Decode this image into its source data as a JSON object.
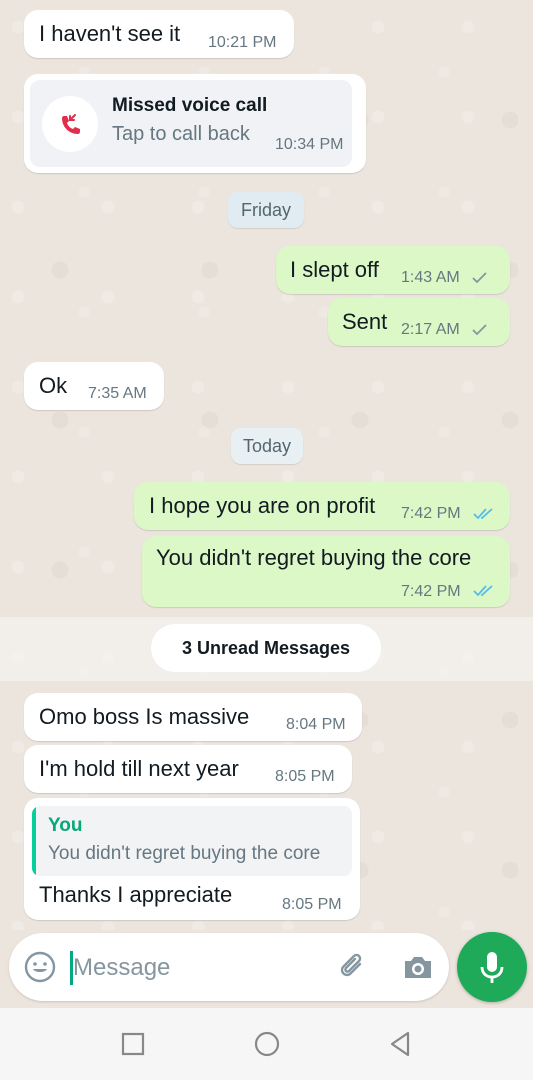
{
  "messages": {
    "m1": {
      "text": "I haven't see it",
      "time": "10:21 PM"
    },
    "call": {
      "title": "Missed voice call",
      "subtitle": "Tap to call back",
      "time": "10:34 PM",
      "icon": "missed-call-icon"
    },
    "day_friday": "Friday",
    "m2": {
      "text": "I slept off",
      "time": "1:43 AM"
    },
    "m3": {
      "text": "Sent",
      "time": "2:17 AM"
    },
    "m4": {
      "text": "Ok",
      "time": "7:35 AM"
    },
    "day_today": "Today",
    "m5": {
      "text": "I hope you are on profit",
      "time": "7:42 PM"
    },
    "m6": {
      "text": "You didn't regret buying the core",
      "time": "7:42 PM"
    },
    "unread_label": "3 Unread Messages",
    "m7": {
      "text": "Omo boss Is massive",
      "time": "8:04 PM"
    },
    "m8": {
      "text": "I'm hold till next year",
      "time": "8:05 PM"
    },
    "m9": {
      "quote_author": "You",
      "quote_text": "You didn't regret buying the core",
      "text": "Thanks I appreciate",
      "time": "8:05 PM"
    }
  },
  "composer": {
    "placeholder": "Message"
  },
  "colors": {
    "outgoing_bubble": "#dcf8c6",
    "incoming_bubble": "#ffffff",
    "accent_green": "#1faa59",
    "read_tick_blue": "#53bdeb",
    "missed_call_red": "#e02e4c",
    "quote_author_green": "#06a878"
  }
}
